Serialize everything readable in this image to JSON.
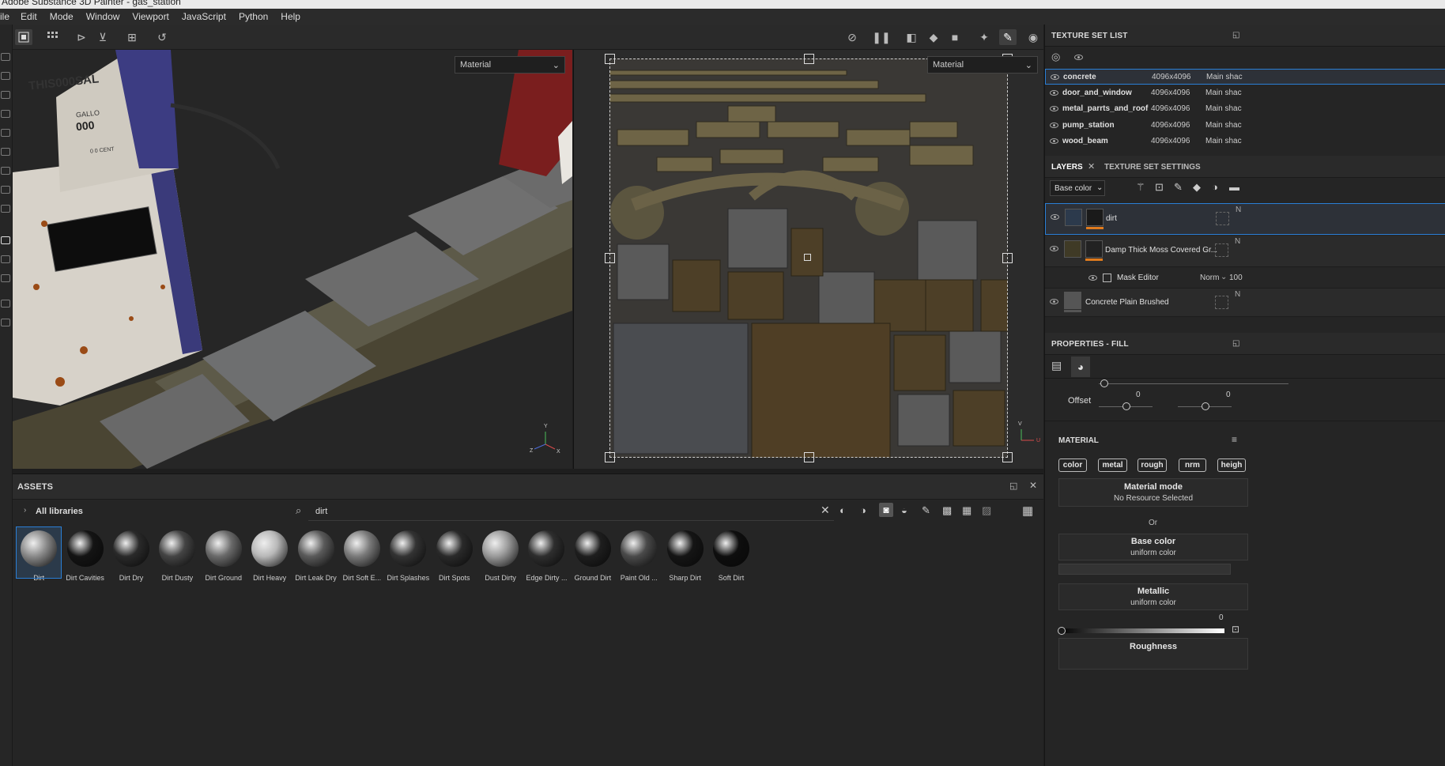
{
  "app": {
    "title": "Adobe Substance 3D Painter - gas_station"
  },
  "menu": [
    "ile",
    "Edit",
    "Mode",
    "Window",
    "Viewport",
    "JavaScript",
    "Python",
    "Help"
  ],
  "viewport3d": {
    "mode_select": "Material",
    "sign_text": "THIS",
    "sign_digits": "000",
    "sign_suffix": "SAL",
    "gallons_label": "GALLO",
    "gallons_digits": "000",
    "cent_label": "0 0 CENT"
  },
  "viewport2d": {
    "mode_select": "Material"
  },
  "axes": {
    "y": "Y",
    "x": "X",
    "z": "Z",
    "v": "V",
    "u": "U"
  },
  "assets": {
    "title": "ASSETS",
    "library": "All libraries",
    "search": "dirt",
    "items": [
      {
        "label": "Dirt",
        "tone": "#8a8a8a"
      },
      {
        "label": "Dirt Cavities",
        "tone": "#141414"
      },
      {
        "label": "Dirt Dry",
        "tone": "#2a2a2a"
      },
      {
        "label": "Dirt Dusty",
        "tone": "#444"
      },
      {
        "label": "Dirt Ground",
        "tone": "#6a6a6a"
      },
      {
        "label": "Dirt Heavy",
        "tone": "#b8b8b8"
      },
      {
        "label": "Dirt Leak Dry",
        "tone": "#5a5a5a"
      },
      {
        "label": "Dirt Soft E...",
        "tone": "#7a7a7a"
      },
      {
        "label": "Dirt Splashes",
        "tone": "#333"
      },
      {
        "label": "Dirt Spots",
        "tone": "#2a2a2a"
      },
      {
        "label": "Dust Dirty",
        "tone": "#9a9a9a"
      },
      {
        "label": "Edge Dirty ...",
        "tone": "#2e2e2e"
      },
      {
        "label": "Ground Dirt",
        "tone": "#1e1e1e"
      },
      {
        "label": "Paint Old ...",
        "tone": "#4a4a4a"
      },
      {
        "label": "Sharp Dirt",
        "tone": "#151515"
      },
      {
        "label": "Soft Dirt",
        "tone": "#0e0e0e"
      }
    ]
  },
  "texture_set_list": {
    "title": "TEXTURE SET LIST",
    "rows": [
      {
        "name": "concrete",
        "res": "4096x4096",
        "shader": "Main shac"
      },
      {
        "name": "door_and_window",
        "res": "4096x4096",
        "shader": "Main shac"
      },
      {
        "name": "metal_parrts_and_roof",
        "res": "4096x4096",
        "shader": "Main shac"
      },
      {
        "name": "pump_station",
        "res": "4096x4096",
        "shader": "Main shac"
      },
      {
        "name": "wood_beam",
        "res": "4096x4096",
        "shader": "Main shac"
      }
    ]
  },
  "layers": {
    "tab_layers": "LAYERS",
    "tab_settings": "TEXTURE SET SETTINGS",
    "channel": "Base color",
    "items": [
      {
        "name": "dirt",
        "right": "N"
      },
      {
        "name": "Damp Thick Moss Covered Gr...",
        "right": "N"
      },
      {
        "name": "Mask Editor",
        "blend": "Norm",
        "opacity": "100"
      },
      {
        "name": "Concrete Plain Brushed",
        "right": "N"
      }
    ]
  },
  "properties": {
    "title": "PROPERTIES - FILL",
    "offset_label": "Offset",
    "offset_x": "0",
    "offset_y": "0",
    "material_title": "MATERIAL",
    "chips": [
      "color",
      "metal",
      "rough",
      "nrm",
      "heigh"
    ],
    "material_mode": {
      "title": "Material mode",
      "value": "No Resource Selected"
    },
    "or": "Or",
    "base_color": {
      "title": "Base color",
      "value": "uniform color"
    },
    "metallic": {
      "title": "Metallic",
      "value": "uniform color",
      "slider_value": "0"
    },
    "roughness": {
      "title": "Roughness"
    }
  },
  "colors": {
    "accent": "#2a7fd6",
    "orange": "#e07b1d",
    "panel": "#252525"
  }
}
